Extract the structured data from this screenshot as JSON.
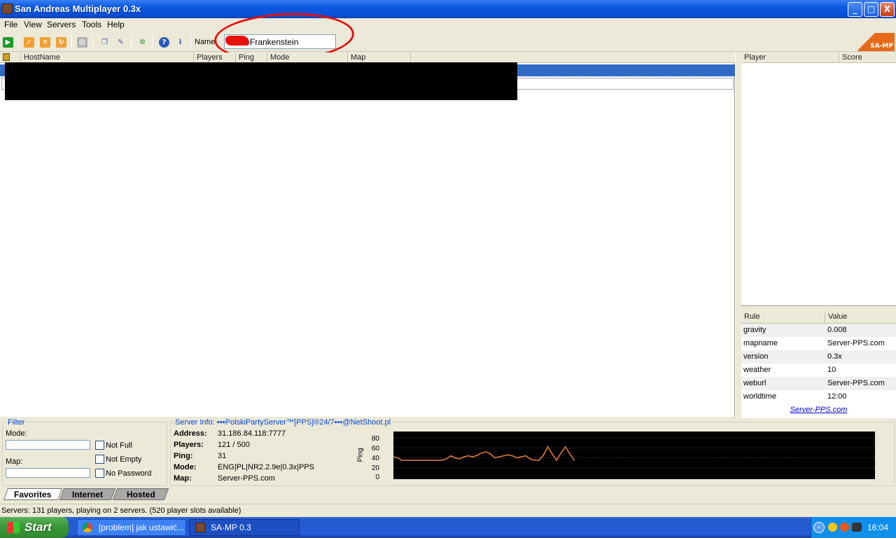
{
  "window": {
    "title": "San Andreas Multiplayer 0.3x",
    "minimize": "_",
    "maximize": "□",
    "close": "X"
  },
  "menu": [
    "File",
    "View",
    "Servers",
    "Tools",
    "Help"
  ],
  "toolbar": {
    "name_label": "Name:",
    "name_value": "Frankenstein",
    "logo": "SA-MP",
    "icons": [
      "connect-icon",
      "add-server-icon",
      "delete-server-icon",
      "refresh-icon",
      "properties-icon",
      "copy-icon",
      "edit-icon",
      "rcon-icon",
      "help-icon",
      "about-icon"
    ]
  },
  "server_list": {
    "columns": [
      "HostName",
      "Players",
      "Ping",
      "Mode",
      "Map"
    ]
  },
  "player_panel": {
    "columns": [
      "Player",
      "Score"
    ]
  },
  "rules_panel": {
    "columns": [
      "Rule",
      "Value"
    ],
    "rows": [
      {
        "rule": "gravity",
        "value": "0.008"
      },
      {
        "rule": "mapname",
        "value": "Server-PPS.com"
      },
      {
        "rule": "version",
        "value": "0.3x"
      },
      {
        "rule": "weather",
        "value": "10"
      },
      {
        "rule": "weburl",
        "value": "Server-PPS.com"
      },
      {
        "rule": "worldtime",
        "value": "12:00"
      }
    ],
    "link": "Server-PPS.com"
  },
  "filter": {
    "title": "Filter",
    "mode_label": "Mode:",
    "map_label": "Map:",
    "not_full": "Not Full",
    "not_empty": "Not Empty",
    "no_password": "No Password"
  },
  "server_info": {
    "title": "Server Info: ▪▪▪PolskiPartyServer™[PPS]®24/7▪▪▪@NetShoot.pl",
    "address_label": "Address:",
    "address": "31.186.84.118:7777",
    "players_label": "Players:",
    "players": "121 / 500",
    "ping_label": "Ping:",
    "ping": "31",
    "mode_label": "Mode:",
    "mode": "ENG|PL|NR2.2.9e|0.3x|PPS",
    "map_label": "Map:",
    "map": "Server-PPS.com"
  },
  "chart_data": {
    "type": "line",
    "ylabel": "Ping",
    "ylim": [
      0,
      90
    ],
    "yticks": [
      "80",
      "60",
      "40",
      "20",
      "0"
    ],
    "series": [
      {
        "values": [
          42,
          40,
          35,
          35,
          35,
          35,
          35,
          35,
          35,
          35,
          35,
          35,
          38,
          44,
          40,
          38,
          42,
          44,
          42,
          45,
          50,
          52,
          48,
          40,
          42,
          44,
          46,
          44,
          40,
          42,
          44,
          38,
          35,
          35,
          45,
          62,
          48,
          35,
          50,
          62,
          48,
          35
        ]
      }
    ],
    "color": "#e8813a"
  },
  "tabs": [
    "Favorites",
    "Internet",
    "Hosted"
  ],
  "status": "Servers: 131 players, playing on 2 servers. (520 player slots available)",
  "taskbar": {
    "start": "Start",
    "task1": "[problem] jak ustawić...",
    "task2": "SA-MP 0.3",
    "clock": "16:04"
  }
}
